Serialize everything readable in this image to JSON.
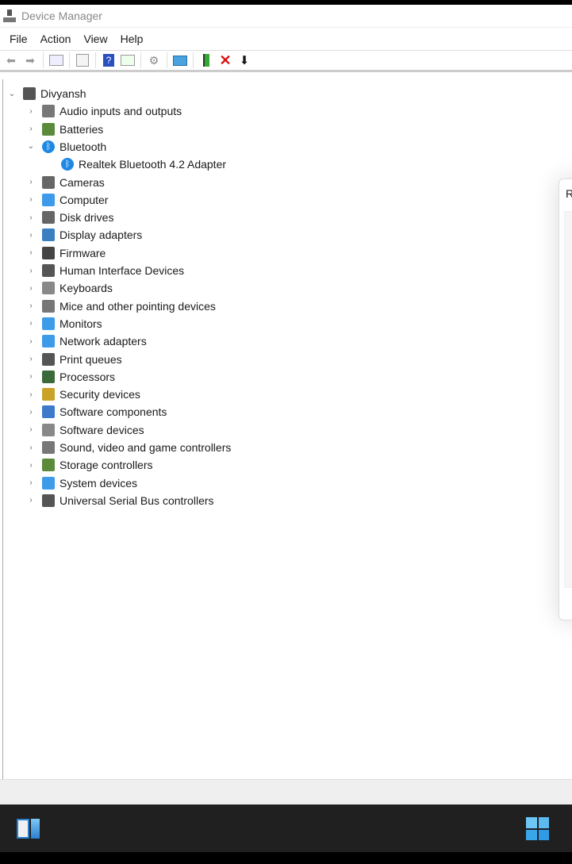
{
  "window": {
    "title": "Device Manager"
  },
  "menu": [
    "File",
    "Action",
    "View",
    "Help"
  ],
  "toolbar": [
    "back-icon",
    "forward-icon",
    "show-hide-console-tree-icon",
    "properties-icon",
    "help-icon",
    "action-pane-icon",
    "update-driver-icon",
    "scan-hardware-icon",
    "enable-device-icon",
    "uninstall-icon",
    "disable-icon"
  ],
  "tree": {
    "root": "Divyansh",
    "items": [
      {
        "label": "Audio inputs and outputs",
        "icon": "speaker",
        "color": "#777"
      },
      {
        "label": "Batteries",
        "icon": "battery",
        "color": "#5a8a3a"
      },
      {
        "label": "Bluetooth",
        "icon": "bluetooth",
        "color": "#1e88e5",
        "expanded": true,
        "children": [
          "Realtek Bluetooth 4.2 Adapter"
        ]
      },
      {
        "label": "Cameras",
        "icon": "camera",
        "color": "#666"
      },
      {
        "label": "Computer",
        "icon": "monitor",
        "color": "#3d9be9"
      },
      {
        "label": "Disk drives",
        "icon": "disk",
        "color": "#666"
      },
      {
        "label": "Display adapters",
        "icon": "display",
        "color": "#3a7fbf"
      },
      {
        "label": "Firmware",
        "icon": "chip",
        "color": "#444"
      },
      {
        "label": "Human Interface Devices",
        "icon": "hid",
        "color": "#555"
      },
      {
        "label": "Keyboards",
        "icon": "keyboard",
        "color": "#888"
      },
      {
        "label": "Mice and other pointing devices",
        "icon": "mouse",
        "color": "#777"
      },
      {
        "label": "Monitors",
        "icon": "monitor",
        "color": "#3d9be9"
      },
      {
        "label": "Network adapters",
        "icon": "network",
        "color": "#3d9be9"
      },
      {
        "label": "Print queues",
        "icon": "printer",
        "color": "#555"
      },
      {
        "label": "Processors",
        "icon": "cpu",
        "color": "#3a6a3a"
      },
      {
        "label": "Security devices",
        "icon": "security",
        "color": "#c9a227"
      },
      {
        "label": "Software components",
        "icon": "component",
        "color": "#3d7ac9"
      },
      {
        "label": "Software devices",
        "icon": "device",
        "color": "#888"
      },
      {
        "label": "Sound, video and game controllers",
        "icon": "speaker",
        "color": "#777"
      },
      {
        "label": "Storage controllers",
        "icon": "storage",
        "color": "#5a8a3a"
      },
      {
        "label": "System devices",
        "icon": "folder",
        "color": "#3d9be9"
      },
      {
        "label": "Universal Serial Bus controllers",
        "icon": "usb",
        "color": "#555"
      }
    ]
  },
  "dialog": {
    "title_partial": "R"
  }
}
